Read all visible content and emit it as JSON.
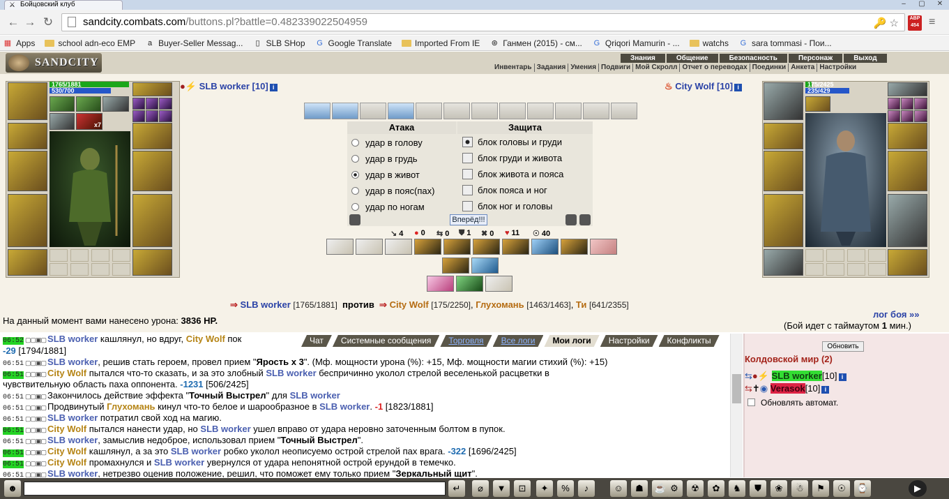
{
  "browser": {
    "tab_title": "Бойцовский клуб",
    "url_host": "sandcity.combats.com",
    "url_path": "/buttons.pl?battle=0.482339022504959",
    "abp_label": "ABP",
    "abp_count": "454",
    "bookmarks": [
      {
        "label": "Apps",
        "icon": "apps-grid-icon"
      },
      {
        "label": "school adn-eco EMP",
        "icon": "folder-icon"
      },
      {
        "label": "Buyer-Seller Messag...",
        "icon": "amazon-icon"
      },
      {
        "label": "SLB SHop",
        "icon": "page-icon"
      },
      {
        "label": "Google Translate",
        "icon": "translate-icon"
      },
      {
        "label": "Imported From IE",
        "icon": "folder-icon"
      },
      {
        "label": "Ганмен (2015) - см...",
        "icon": "film-icon"
      },
      {
        "label": "Qriqori Mamurin - ...",
        "icon": "google-icon"
      },
      {
        "label": "watchs",
        "icon": "folder-icon"
      },
      {
        "label": "sara tommasi - Пои...",
        "icon": "google-icon"
      }
    ]
  },
  "game": {
    "logo": "SANDCITY",
    "top_nav": [
      "Знания",
      "Общение",
      "Безопасность",
      "Персонаж",
      "Выход"
    ],
    "sub_nav": [
      "Инвентарь",
      "Задания",
      "Умения",
      "Подвиги",
      "Мой Скролл",
      "Отчет о переводах",
      "Поединки",
      "Анкета",
      "Настройки"
    ],
    "left_player": {
      "name": "SLB worker",
      "level": "[10]",
      "hp": "1765/1881",
      "hp_fraction": 0.938,
      "mana": "530/700",
      "mana_fraction": 0.757,
      "effect_count": "x7"
    },
    "right_player": {
      "name": "City Wolf",
      "level": "[10]",
      "hp": "175/2425",
      "hp_fraction": 0.072,
      "mana": "235/429",
      "mana_fraction": 0.548
    },
    "attack": {
      "title": "Атака",
      "options": [
        "удар в голову",
        "удар в грудь",
        "удар в живот",
        "удар в пояс(пах)",
        "удар по ногам"
      ],
      "selected": 2
    },
    "defense": {
      "title": "Защита",
      "options": [
        "блок головы и груди",
        "блок груди и живота",
        "блок живота и пояса",
        "блок пояса и ног",
        "блок ног и головы"
      ],
      "selected": 0
    },
    "go_button": "Вперёд!!!",
    "stats": [
      {
        "icon": "hit-icon",
        "value": "4"
      },
      {
        "icon": "blood-icon",
        "value": "0"
      },
      {
        "icon": "counter-icon",
        "value": "0"
      },
      {
        "icon": "shield-icon",
        "value": "1"
      },
      {
        "icon": "cross-icon",
        "value": "0"
      },
      {
        "icon": "heart-icon",
        "value": "11"
      },
      {
        "icon": "spirit-icon",
        "value": "40"
      }
    ],
    "versus": {
      "player": "SLB worker",
      "player_hp": "[1765/1881]",
      "vs": "против",
      "opponents": [
        {
          "name": "City Wolf",
          "hp": "[175/2250]"
        },
        {
          "name": "Глухомань",
          "hp": "[1463/1463]"
        },
        {
          "name": "Ти",
          "hp": "[641/2355]"
        }
      ]
    },
    "damage_text": "На данный момент вами нанесено урона:",
    "damage_value": "3836 HP.",
    "battle_log_link": "лог боя »»",
    "timeout_prefix": "(Бой идет с таймаутом",
    "timeout_value": "1",
    "timeout_suffix": "мин.)"
  },
  "chat": {
    "tabs": [
      "Чат",
      "Системные сообщения",
      "Торговля",
      "Все логи",
      "Мои логи",
      "Настройки",
      "Конфликты"
    ],
    "active_tab": "Мои логи",
    "lines": [
      {
        "time": "06:52",
        "green": true,
        "parts": [
          {
            "t": "SLB worker",
            "c": "cn"
          },
          {
            "t": " кашлянул, но вдруг, "
          },
          {
            "t": "City Wolf",
            "c": "co"
          },
          {
            "t": " пок"
          }
        ]
      },
      {
        "time": "",
        "green": false,
        "parts": [
          {
            "t": "-29",
            "c": "dmg"
          },
          {
            "t": " [1794/1881]"
          }
        ]
      },
      {
        "time": "06:51",
        "green": false,
        "parts": [
          {
            "t": "SLB worker",
            "c": "cn"
          },
          {
            "t": ", решив стать героем, провел прием \""
          },
          {
            "t": "Ярость х 3",
            "c": "b"
          },
          {
            "t": "\". (Мф. мощности урона (%): +15, Мф. мощности магии стихий (%): +15)"
          }
        ]
      },
      {
        "time": "06:51",
        "green": true,
        "parts": [
          {
            "t": "City Wolf",
            "c": "co"
          },
          {
            "t": " пытался что-то сказать, и за это злобный "
          },
          {
            "t": "SLB worker",
            "c": "cn"
          },
          {
            "t": " беспричинно уколол стрелой веселенькой расцветки в"
          }
        ]
      },
      {
        "time": "",
        "green": false,
        "parts": [
          {
            "t": "чувствительную область паха оппонента. "
          },
          {
            "t": "-1231",
            "c": "dmg"
          },
          {
            "t": " [506/2425]"
          }
        ]
      },
      {
        "time": "06:51",
        "green": false,
        "parts": [
          {
            "t": "Закончилось действие эффекта \""
          },
          {
            "t": "Точный Выстрел",
            "c": "b"
          },
          {
            "t": "\" для "
          },
          {
            "t": "SLB worker",
            "c": "cn"
          }
        ]
      },
      {
        "time": "06:51",
        "green": false,
        "parts": [
          {
            "t": "Продвинутый "
          },
          {
            "t": "Глухомань",
            "c": "co"
          },
          {
            "t": " кинул что-то белое и шарообразное в "
          },
          {
            "t": "SLB worker",
            "c": "cn"
          },
          {
            "t": ". "
          },
          {
            "t": "-1",
            "c": "dmgr"
          },
          {
            "t": " [1823/1881]"
          }
        ]
      },
      {
        "time": "06:51",
        "green": false,
        "parts": [
          {
            "t": "SLB worker",
            "c": "cn"
          },
          {
            "t": " потратил свой ход на магию."
          }
        ]
      },
      {
        "time": "06:51",
        "green": true,
        "parts": [
          {
            "t": "City Wolf",
            "c": "co"
          },
          {
            "t": " пытался нанести удар, но "
          },
          {
            "t": "SLB worker",
            "c": "cn"
          },
          {
            "t": " ушел вправо от удара неровно заточенным болтом в пупок."
          }
        ]
      },
      {
        "time": "06:51",
        "green": false,
        "parts": [
          {
            "t": "SLB worker",
            "c": "cn"
          },
          {
            "t": ", замыслив недоброе, использовал прием \""
          },
          {
            "t": "Точный Выстрел",
            "c": "b"
          },
          {
            "t": "\"."
          }
        ]
      },
      {
        "time": "06:51",
        "green": true,
        "parts": [
          {
            "t": "City Wolf",
            "c": "co"
          },
          {
            "t": " кашлянул, а за это "
          },
          {
            "t": "SLB worker",
            "c": "cn"
          },
          {
            "t": " робко уколол неописуемо острой стрелой пах врага. "
          },
          {
            "t": "-322",
            "c": "dmg"
          },
          {
            "t": " [1696/2425]"
          }
        ]
      },
      {
        "time": "06:51",
        "green": true,
        "parts": [
          {
            "t": "City Wolf",
            "c": "co"
          },
          {
            "t": " промахнулся и "
          },
          {
            "t": "SLB worker",
            "c": "cn"
          },
          {
            "t": " увернулся от удара непонятной острой ерундой в темечко."
          }
        ]
      },
      {
        "time": "06:51",
        "green": false,
        "parts": [
          {
            "t": "SLB worker",
            "c": "cn"
          },
          {
            "t": ", нетрезво оценив положение, решил, что поможет ему только прием \""
          },
          {
            "t": "Зеркальный щит",
            "c": "b"
          },
          {
            "t": "\"."
          }
        ]
      }
    ]
  },
  "online": {
    "refresh": "Обновить",
    "room": "Колдовской мир (2)",
    "users": [
      {
        "name": "SLB worker",
        "level": "[10]",
        "bg": "#33dd33"
      },
      {
        "name": "Verasok",
        "level": "[10]",
        "bg": "#dd2244"
      }
    ],
    "auto_refresh": "Обновлять автомат."
  },
  "colors": {
    "player_blue": "#2a42a6",
    "opponent_gold": "#b58415",
    "hp_green": "#1aa61a",
    "mana_blue": "#2556c9",
    "room_red": "#a3231a"
  }
}
